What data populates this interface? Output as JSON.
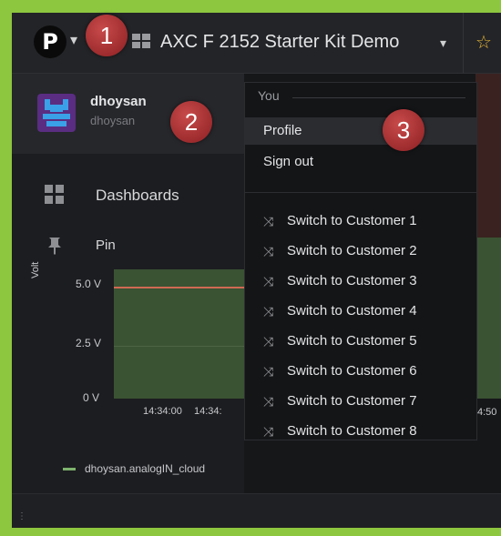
{
  "app": {
    "logo_glyph": "P",
    "dashboard_title": "AXC F 2152 Starter Kit Demo",
    "title_caret": "▾",
    "logo_caret": "▾",
    "star_icon": "star-icon",
    "accent_star": "#e8b73a"
  },
  "sidebar": {
    "username": "dhoysan",
    "userlogin": "dhoysan",
    "items": [
      {
        "label": "Dashboards",
        "icon": "dashboards-grid-icon"
      },
      {
        "label": "Pin",
        "icon": "pin-icon"
      }
    ]
  },
  "dropdown": {
    "header": "You",
    "items": [
      {
        "label": "Profile",
        "active": true
      },
      {
        "label": "Sign out",
        "active": false
      }
    ],
    "switch_items": [
      "Switch to Customer 1",
      "Switch to Customer 2",
      "Switch to Customer 3",
      "Switch to Customer 4",
      "Switch to Customer 5",
      "Switch to Customer 6",
      "Switch to Customer 7",
      "Switch to Customer 8"
    ]
  },
  "panel": {
    "ylabel": "Volt",
    "yticks": [
      "5.0 V",
      "2.5 V",
      "0 V"
    ],
    "xticks": [
      "14:34:00",
      "14:34:",
      "4:50"
    ],
    "legend": "dhoysan.analogIN_cloud",
    "legend_color": "#7eb26d",
    "threshold_color": "#d06a54"
  },
  "callouts": [
    "1",
    "2",
    "3"
  ]
}
